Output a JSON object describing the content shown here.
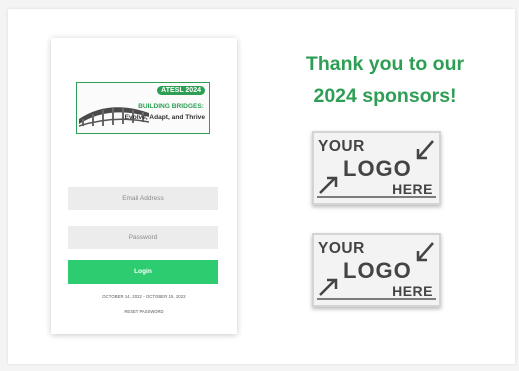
{
  "login_mockup": {
    "banner": {
      "tag": "ATESL 2024",
      "title": "BUILDING BRIDGES:",
      "subtitle": "Evolve, Adapt, and Thrive"
    },
    "email_placeholder": "Email Address",
    "password_placeholder": "Password",
    "login_label": "Login",
    "dates": "OCTOBER 14, 2022  -  OCTOBER 15, 2022",
    "reset_label": "RESET PASSWORD"
  },
  "sponsors": {
    "heading_line1": "Thank you to our",
    "heading_line2": "2024 sponsors!",
    "placeholders": [
      {
        "your": "YOUR",
        "logo": "LOGO",
        "here": "HERE"
      },
      {
        "your": "YOUR",
        "logo": "LOGO",
        "here": "HERE"
      }
    ]
  },
  "colors": {
    "brand_green": "#2f9e55",
    "button_green": "#2ecc71"
  }
}
